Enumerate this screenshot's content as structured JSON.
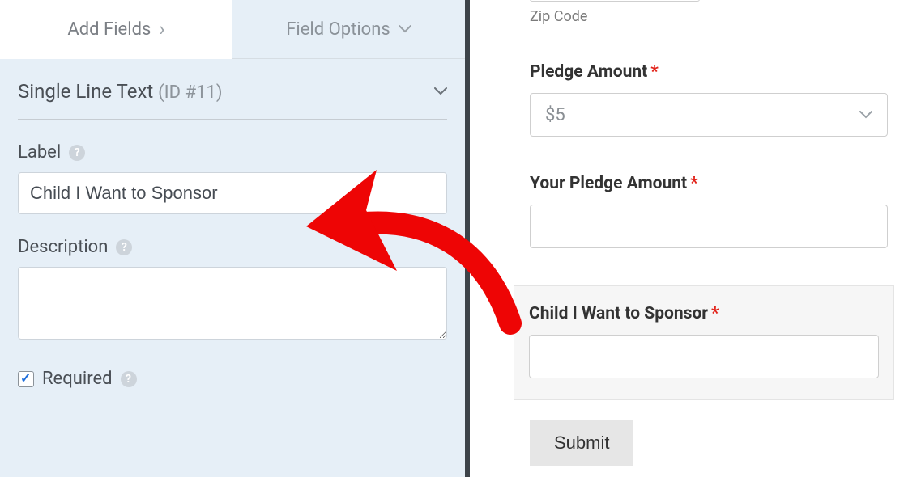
{
  "tabs": {
    "add_fields": "Add Fields",
    "field_options": "Field Options"
  },
  "section": {
    "title": "Single Line Text",
    "id_label": "(ID #11)"
  },
  "label_field": {
    "label": "Label",
    "value": "Child I Want to Sponsor"
  },
  "description_field": {
    "label": "Description",
    "value": ""
  },
  "required": {
    "label": "Required",
    "checked": true
  },
  "preview": {
    "zip_sub_label": "Zip Code",
    "pledge_amount": {
      "label": "Pledge Amount",
      "selected": "$5"
    },
    "your_pledge_amount": {
      "label": "Your Pledge Amount"
    },
    "child_sponsor": {
      "label": "Child I Want to Sponsor"
    },
    "submit": "Submit"
  }
}
